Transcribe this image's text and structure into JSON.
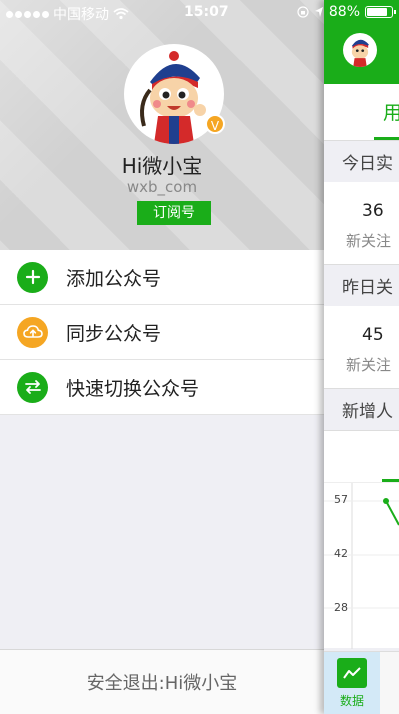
{
  "status_bar": {
    "carrier": "中国移动",
    "time": "15:07",
    "battery": "88%"
  },
  "profile": {
    "name": "Hi微小宝",
    "id": "wxb_com",
    "type_label": "订阅号",
    "verified_badge": "V"
  },
  "menu": {
    "items": [
      {
        "label": "添加公众号",
        "icon": "plus-icon",
        "color": "#1aad19"
      },
      {
        "label": "同步公众号",
        "icon": "cloud-sync-icon",
        "color": "#f5a623"
      },
      {
        "label": "快速切换公众号",
        "icon": "switch-icon",
        "color": "#1aad19"
      }
    ]
  },
  "logout_label": "安全退出:Hi微小宝",
  "panel": {
    "tab_label": "用",
    "sections": [
      {
        "header": "今日实",
        "value": "36",
        "caption": "新关注"
      },
      {
        "header": "昨日关",
        "value": "45",
        "caption": "新关注"
      }
    ],
    "chart_section_header": "新增人",
    "chart": {
      "y_ticks": [
        "57",
        "42",
        "28"
      ]
    },
    "bottom_tab_label": "数据"
  },
  "colors": {
    "brand_green": "#1aad19",
    "accent_orange": "#f5a623"
  }
}
